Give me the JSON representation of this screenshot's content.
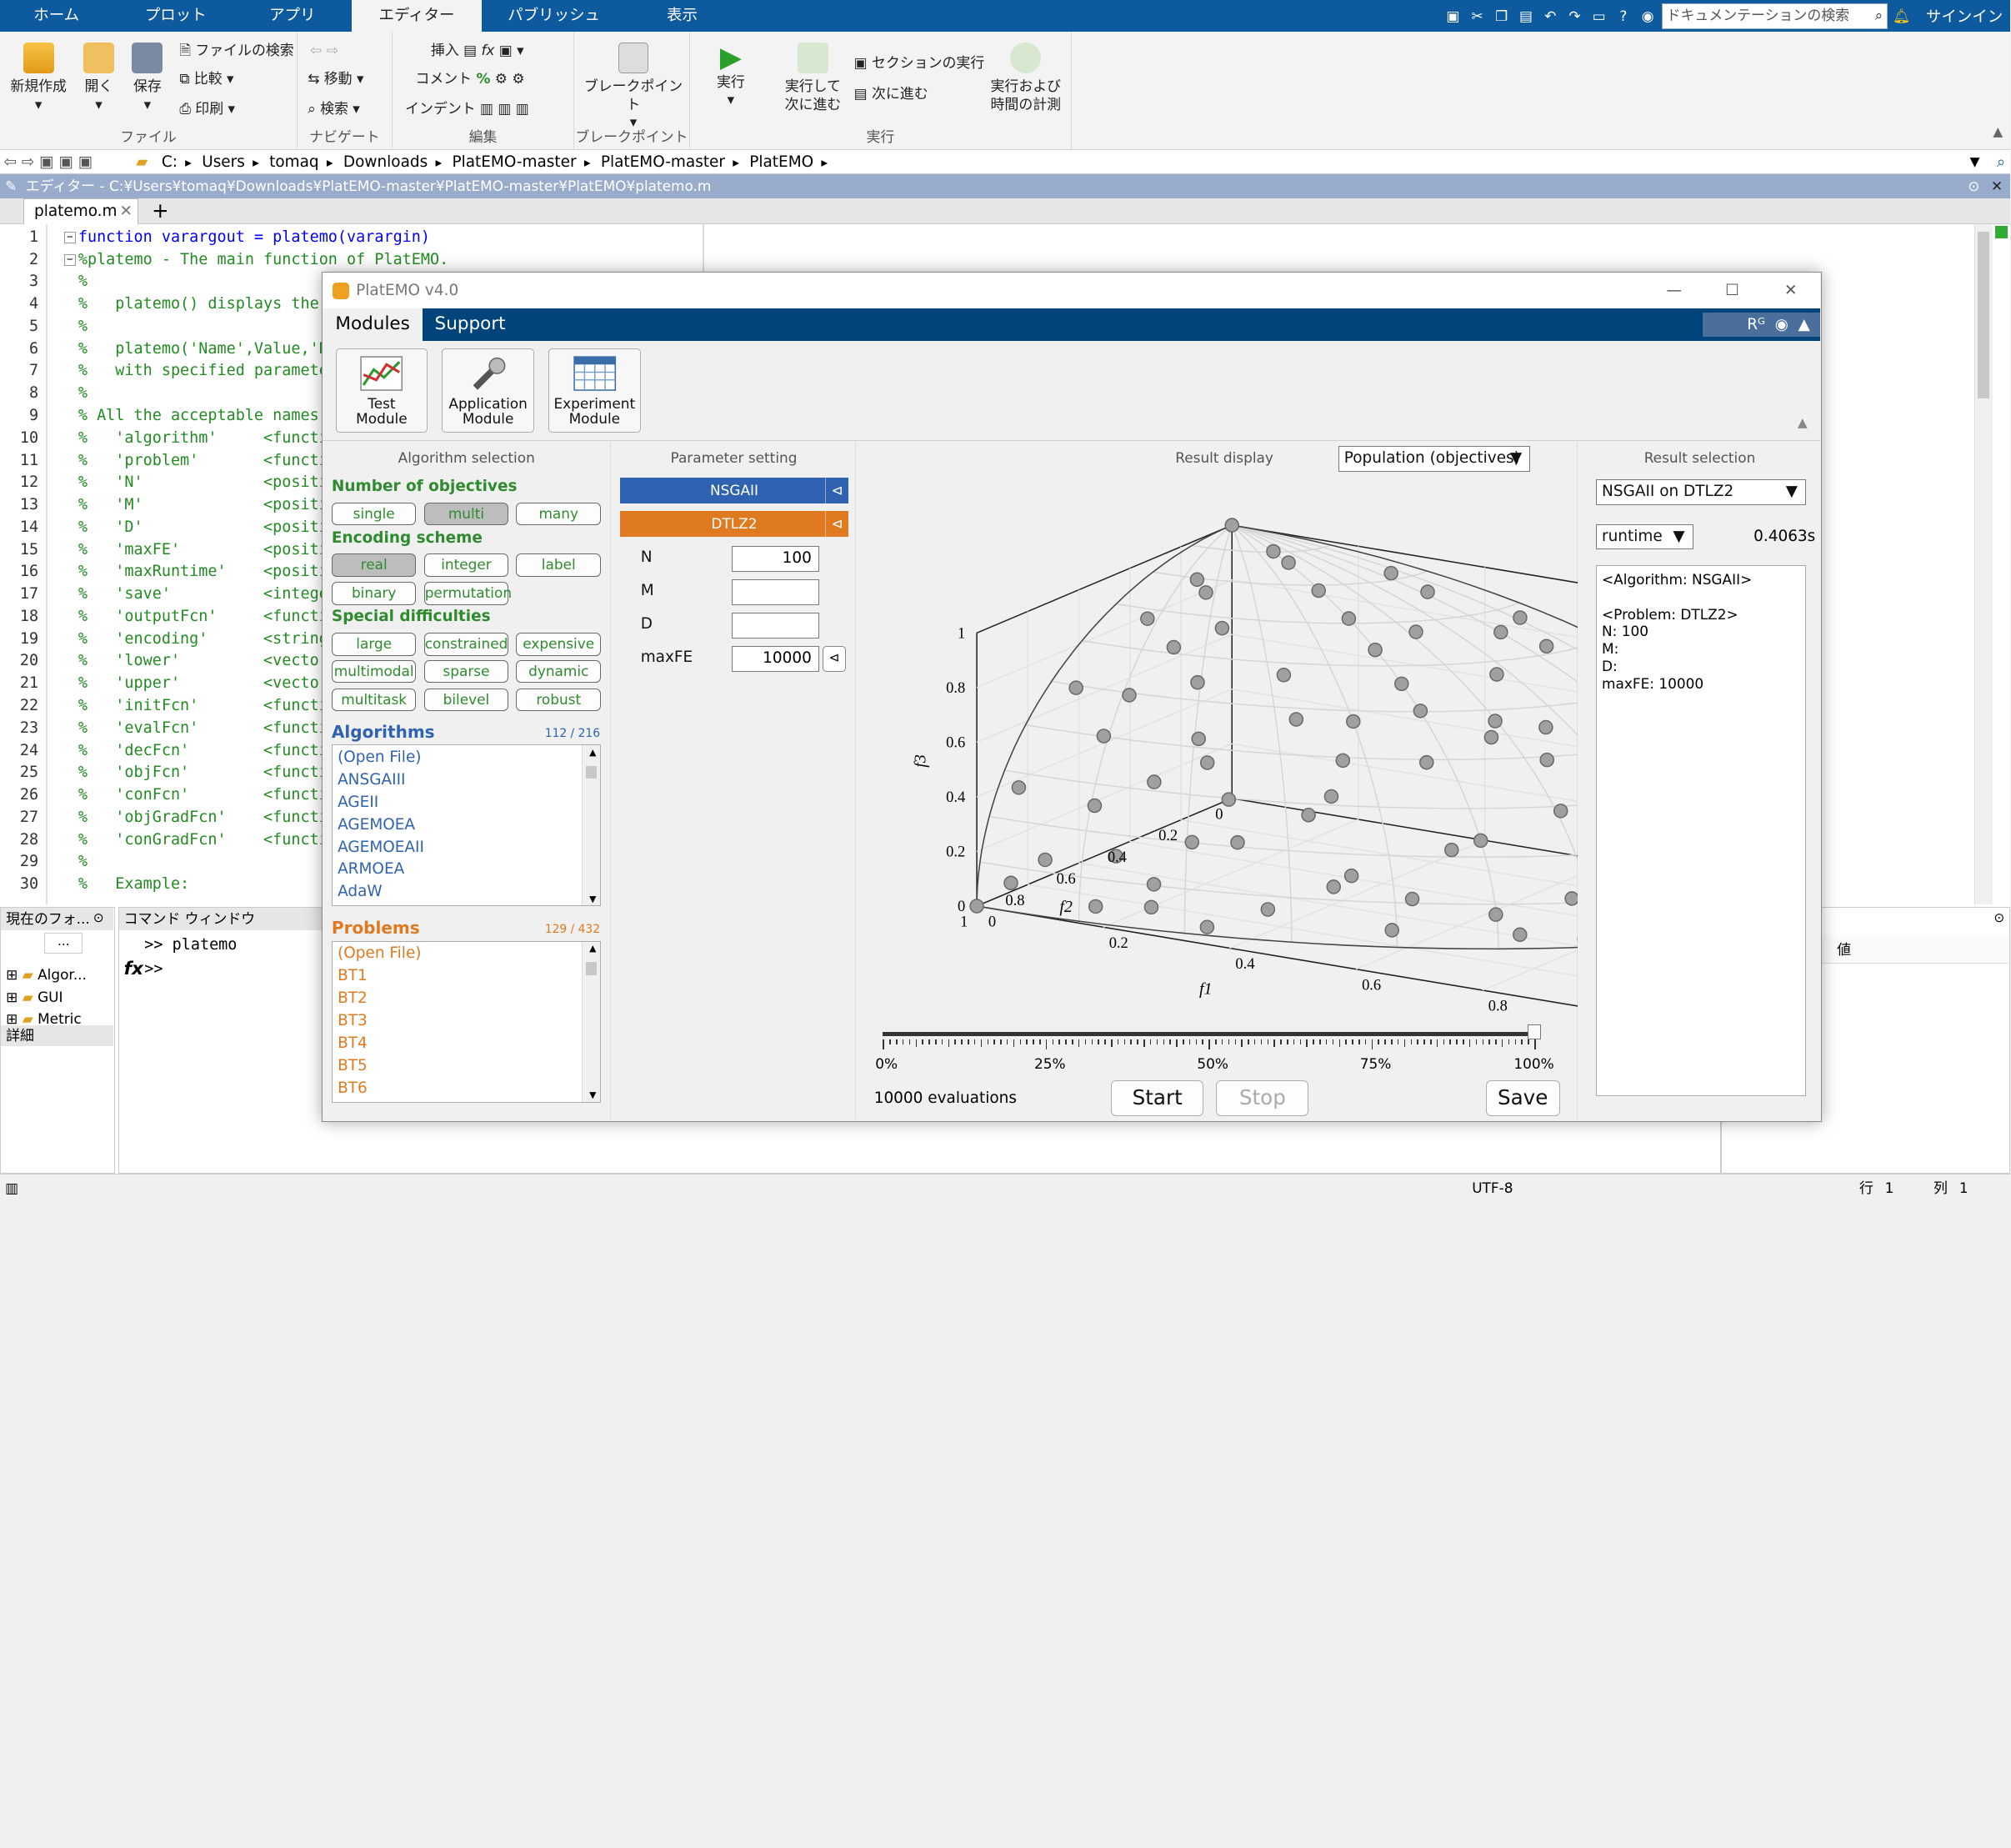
{
  "matlab": {
    "tabs": [
      "ホーム",
      "プロット",
      "アプリ",
      "エディター",
      "パブリッシュ",
      "表示"
    ],
    "doc_search_placeholder": "ドキュメンテーションの検索",
    "signin": "サインイン",
    "ribbon": {
      "file": {
        "new": "新規作成",
        "open": "開く",
        "save": "保存",
        "find_files": "ファイルの検索",
        "compare": "比較",
        "print": "印刷",
        "label": "ファイル"
      },
      "navigate": {
        "goto": "移動",
        "find": "検索",
        "label": "ナビゲート"
      },
      "edit": {
        "insert": "挿入",
        "fx": "fx",
        "comment": "コメント",
        "comment_sym": "%",
        "indent": "インデント",
        "label": "編集"
      },
      "breakpoints": {
        "btn": "ブレークポイント",
        "label": "ブレークポイント"
      },
      "run": {
        "run": "実行",
        "run_advance_1": "実行して",
        "run_advance_2": "次に進む",
        "run_section": "セクションの実行",
        "advance": "次に進む",
        "run_time_1": "実行および",
        "run_time_2": "時間の計測",
        "label": "実行"
      }
    },
    "path": [
      "C:",
      "Users",
      "tomaq",
      "Downloads",
      "PlatEMO-master",
      "PlatEMO-master",
      "PlatEMO"
    ],
    "editor_title": "エディター - C:¥Users¥tomaq¥Downloads¥PlatEMO-master¥PlatEMO-master¥PlatEMO¥platemo.m",
    "editor_tab": "platemo.m",
    "editor_tab_add": "+",
    "code_lines": [
      {
        "n": "1",
        "t": "function varargout = platemo(varargin)",
        "kw": true
      },
      {
        "n": "2",
        "t": "%platemo - The main function of PlatEMO."
      },
      {
        "n": "3",
        "t": "%"
      },
      {
        "n": "4",
        "t": "%   platemo() displays the GU"
      },
      {
        "n": "5",
        "t": "%"
      },
      {
        "n": "6",
        "t": "%   platemo('Name',Value,'Nam"
      },
      {
        "n": "7",
        "t": "%   with specified parameter"
      },
      {
        "n": "8",
        "t": "%"
      },
      {
        "n": "9",
        "t": "% All the acceptable names an"
      },
      {
        "n": "10",
        "t": "%   'algorithm'     <function"
      },
      {
        "n": "11",
        "t": "%   'problem'       <function"
      },
      {
        "n": "12",
        "t": "%   'N'             <positive"
      },
      {
        "n": "13",
        "t": "%   'M'             <positive"
      },
      {
        "n": "14",
        "t": "%   'D'             <positive"
      },
      {
        "n": "15",
        "t": "%   'maxFE'         <positive"
      },
      {
        "n": "16",
        "t": "%   'maxRuntime'    <positive"
      },
      {
        "n": "17",
        "t": "%   'save'          <integer>"
      },
      {
        "n": "18",
        "t": "%   'outputFcn'     <function"
      },
      {
        "n": "19",
        "t": "%   'encoding'      <string>"
      },
      {
        "n": "20",
        "t": "%   'lower'         <vector>"
      },
      {
        "n": "21",
        "t": "%   'upper'         <vector>"
      },
      {
        "n": "22",
        "t": "%   'initFcn'       <function"
      },
      {
        "n": "23",
        "t": "%   'evalFcn'       <function"
      },
      {
        "n": "24",
        "t": "%   'decFcn'        <function"
      },
      {
        "n": "25",
        "t": "%   'objFcn'        <function"
      },
      {
        "n": "26",
        "t": "%   'conFcn'        <function"
      },
      {
        "n": "27",
        "t": "%   'objGradFcn'    <function"
      },
      {
        "n": "28",
        "t": "%   'conGradFcn'    <function"
      },
      {
        "n": "29",
        "t": "%"
      },
      {
        "n": "30",
        "t": "%   Example:"
      }
    ],
    "current_folder": {
      "title": "現在のフォ...",
      "path_btn": "...",
      "items": [
        "Algor...",
        "GUI",
        "Metric"
      ],
      "details": "詳細"
    },
    "command_window": {
      "title": "コマンド ウィンドウ",
      "line1": ">> platemo",
      "prompt": ">>",
      "fx": "fx"
    },
    "workspace": {
      "col": "値"
    },
    "status": {
      "encoding": "UTF-8",
      "row_label": "行",
      "row": "1",
      "col_label": "列",
      "col": "1"
    }
  },
  "platemo": {
    "title": "PlatEMO v4.0",
    "menu": [
      "Modules",
      "Support"
    ],
    "modules": [
      {
        "l1": "Test",
        "l2": "Module"
      },
      {
        "l1": "Application",
        "l2": "Module"
      },
      {
        "l1": "Experiment",
        "l2": "Module"
      }
    ],
    "algo": {
      "header": "Algorithm selection",
      "num_obj": "Number of objectives",
      "obj_opts": [
        "single",
        "multi",
        "many"
      ],
      "encoding": "Encoding scheme",
      "enc_opts": [
        "real",
        "integer",
        "label",
        "binary",
        "permutation"
      ],
      "special": "Special difficulties",
      "spec_opts": [
        "large",
        "constrained",
        "expensive",
        "multimodal",
        "sparse",
        "dynamic",
        "multitask",
        "bilevel",
        "robust"
      ],
      "alg_title": "Algorithms",
      "alg_count": "112 / 216",
      "alg_list": [
        "(Open File)",
        "ANSGAIII",
        "AGEII",
        "AGEMOEA",
        "AGEMOEAII",
        "ARMOEA",
        "AdaW"
      ],
      "prob_title": "Problems",
      "prob_count": "129 / 432",
      "prob_list": [
        "(Open File)",
        "BT1",
        "BT2",
        "BT3",
        "BT4",
        "BT5",
        "BT6"
      ]
    },
    "param": {
      "header": "Parameter setting",
      "alg": "NSGAII",
      "prob": "DTLZ2",
      "fields": [
        {
          "name": "N",
          "value": "100"
        },
        {
          "name": "M",
          "value": ""
        },
        {
          "name": "D",
          "value": ""
        },
        {
          "name": "maxFE",
          "value": "10000"
        }
      ]
    },
    "result": {
      "header": "Result display",
      "dropdown": "Population (objectives)",
      "progress_pct": 100,
      "progress_ticks": [
        "0%",
        "25%",
        "50%",
        "75%",
        "100%"
      ],
      "evaluations": "10000 evaluations",
      "start": "Start",
      "stop": "Stop",
      "save": "Save"
    },
    "selection": {
      "header": "Result selection",
      "run": "NSGAII on DTLZ2",
      "metric": "runtime",
      "metric_value": "0.4063s",
      "info": [
        "<Algorithm: NSGAII>",
        "",
        "<Problem: DTLZ2>",
        "N: 100",
        "M:",
        "D:",
        "maxFE: 10000"
      ]
    }
  },
  "chart_data": {
    "type": "scatter",
    "projection": "3d",
    "xlabel": "f1",
    "ylabel": "f2",
    "zlabel": "f3",
    "xlim": [
      0,
      1
    ],
    "ylim": [
      0,
      1
    ],
    "zlim": [
      0,
      1
    ],
    "x_ticks": [
      "0",
      "0.2",
      "0.4",
      "0.6",
      "0.8",
      "1"
    ],
    "y_ticks": [
      "0",
      "0.2",
      "0.4",
      "0.6",
      "0.8",
      "1"
    ],
    "z_ticks": [
      "0",
      "0.2",
      "0.4",
      "0.6",
      "0.8",
      "1"
    ],
    "grid": true,
    "point_color": "#a0a0a0",
    "series": [
      {
        "points": [
          [
            0,
            0,
            1
          ],
          [
            1,
            0,
            0
          ],
          [
            0,
            1,
            0
          ],
          [
            0.11,
            0.11,
            0.99
          ],
          [
            0.28,
            0.07,
            0.96
          ],
          [
            0.07,
            0.31,
            0.95
          ],
          [
            0.31,
            0.31,
            0.9
          ],
          [
            0.17,
            0.46,
            0.87
          ],
          [
            0.49,
            0.16,
            0.86
          ],
          [
            0.45,
            0.45,
            0.77
          ],
          [
            0.2,
            0.63,
            0.75
          ],
          [
            0.64,
            0.2,
            0.74
          ],
          [
            0.04,
            0.71,
            0.7
          ],
          [
            0.71,
            0.04,
            0.7
          ],
          [
            0.36,
            0.64,
            0.68
          ],
          [
            0.65,
            0.38,
            0.66
          ],
          [
            0.12,
            0.8,
            0.59
          ],
          [
            0.8,
            0.12,
            0.59
          ],
          [
            0.55,
            0.6,
            0.58
          ],
          [
            0.28,
            0.79,
            0.55
          ],
          [
            0.8,
            0.31,
            0.52
          ],
          [
            0.46,
            0.75,
            0.48
          ],
          [
            0.73,
            0.52,
            0.44
          ],
          [
            0.03,
            0.91,
            0.41
          ],
          [
            0.92,
            0.04,
            0.39
          ],
          [
            0.15,
            0.91,
            0.39
          ],
          [
            0.92,
            0.18,
            0.35
          ],
          [
            0.63,
            0.7,
            0.33
          ],
          [
            0.36,
            0.87,
            0.32
          ],
          [
            0.84,
            0.46,
            0.29
          ],
          [
            0.52,
            0.82,
            0.24
          ],
          [
            0.1,
            0.98,
            0.2
          ],
          [
            0.98,
            0.11,
            0.17
          ],
          [
            0.26,
            0.95,
            0.16
          ],
          [
            0.95,
            0.28,
            0.13
          ],
          [
            0.7,
            0.7,
            0.12
          ],
          [
            0.42,
            0.9,
            0.11
          ],
          [
            0.88,
            0.47,
            0.07
          ],
          [
            0.58,
            0.81,
            0.06
          ],
          [
            0.18,
            0.98,
            0.06
          ],
          [
            0.99,
            0.15,
            0.05
          ],
          [
            0.8,
            0.6,
            0.03
          ],
          [
            0.34,
            0.94,
            0.03
          ],
          [
            0.92,
            0.4,
            0.02
          ],
          [
            0.05,
            0.99,
            0.1
          ],
          [
            0.99,
            0.04,
            0.12
          ],
          [
            0.6,
            0.47,
            0.64
          ],
          [
            0.4,
            0.27,
            0.87
          ],
          [
            0.23,
            0.23,
            0.94
          ],
          [
            0.54,
            0.3,
            0.78
          ],
          [
            0.3,
            0.54,
            0.78
          ],
          [
            0.75,
            0.25,
            0.61
          ],
          [
            0.25,
            0.75,
            0.61
          ],
          [
            0.66,
            0.66,
            0.36
          ],
          [
            0.85,
            0.22,
            0.48
          ],
          [
            0.22,
            0.85,
            0.48
          ],
          [
            0.13,
            0.55,
            0.82
          ],
          [
            0.55,
            0.13,
            0.82
          ],
          [
            0.43,
            0.59,
            0.68
          ],
          [
            0.59,
            0.43,
            0.68
          ],
          [
            0.5,
            0.5,
            0.71
          ],
          [
            0.38,
            0.38,
            0.84
          ],
          [
            0.06,
            0.48,
            0.87
          ],
          [
            0.48,
            0.06,
            0.87
          ],
          [
            0.78,
            0.6,
            0.17
          ],
          [
            0.6,
            0.78,
            0.17
          ],
          [
            0.9,
            0.3,
            0.31
          ],
          [
            0.3,
            0.9,
            0.31
          ],
          [
            0.95,
            0.2,
            0.24
          ],
          [
            0.2,
            0.95,
            0.24
          ],
          [
            0.44,
            0.79,
            0.42
          ],
          [
            0.79,
            0.44,
            0.42
          ],
          [
            0.7,
            0.12,
            0.7
          ],
          [
            0.12,
            0.7,
            0.7
          ],
          [
            0.35,
            0.1,
            0.93
          ],
          [
            0.1,
            0.35,
            0.93
          ],
          [
            0.83,
            0.33,
            0.45
          ],
          [
            0.33,
            0.83,
            0.45
          ],
          [
            0.5,
            0.84,
            0.2
          ],
          [
            0.84,
            0.5,
            0.2
          ],
          [
            0.15,
            0.15,
            0.98
          ],
          [
            0.68,
            0.45,
            0.58
          ],
          [
            0.45,
            0.68,
            0.58
          ],
          [
            0.96,
            0.26,
            0.08
          ],
          [
            0.26,
            0.96,
            0.08
          ],
          [
            0.73,
            0.68,
            0.05
          ]
        ]
      }
    ]
  }
}
